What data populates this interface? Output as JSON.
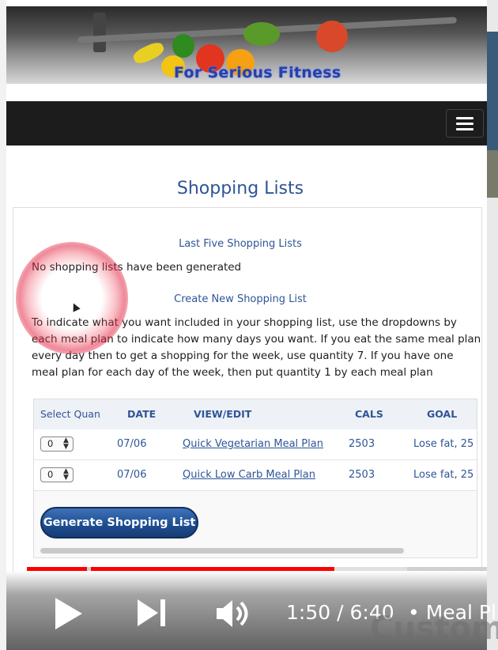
{
  "banner": {
    "tagline": "For Serious Fitness"
  },
  "page": {
    "title": "Shopping Lists"
  },
  "last_five": {
    "heading": "Last Five Shopping Lists",
    "empty_message": "No shopping lists have been generated"
  },
  "create_new": {
    "heading": "Create New Shopping List",
    "instructions": "To indicate what you want included in your shopping list, use the dropdowns by each meal plan to indicate how many days you want. If you eat the same meal plan every day then to get a shopping for the week, use quantity 7. If you have one meal plan for each day of the week, then put quantity 1 by each meal plan"
  },
  "table": {
    "columns": [
      "Select Quan",
      "DATE",
      "VIEW/EDIT",
      "CALS",
      "GOAL"
    ],
    "rows": [
      {
        "quantity": "0",
        "date": "07/06",
        "plan": "Quick Vegetarian Meal Plan",
        "cals": "2503",
        "goal": "Lose fat, 25"
      },
      {
        "quantity": "0",
        "date": "07/06",
        "plan": "Quick Low Carb Meal Plan",
        "cals": "2503",
        "goal": "Lose fat, 25"
      }
    ],
    "generate_label": "Generate Shopping List"
  },
  "video": {
    "time": "1:50 / 6:40",
    "title": "• Meal Pl",
    "watermark": "Custom",
    "progress_fraction": 0.67,
    "icons": [
      "play-icon",
      "next-icon",
      "volume-icon",
      "menu-icon"
    ]
  },
  "colors": {
    "link": "#2f5597",
    "navbar": "#1c1c1c",
    "progress": "#ff0000",
    "button": "#1f4f92"
  }
}
